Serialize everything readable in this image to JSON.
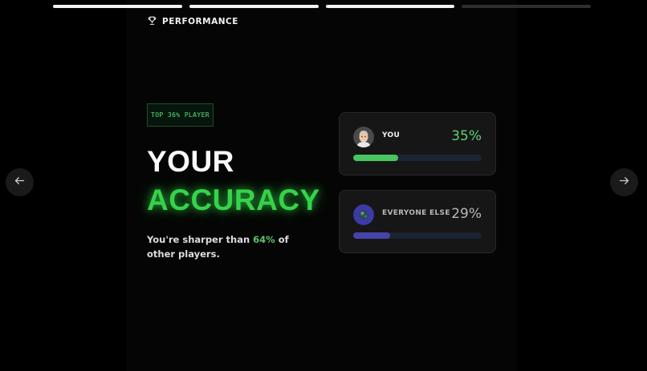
{
  "progress": {
    "total": 4,
    "completed": 3
  },
  "header": {
    "title": "PERFORMANCE",
    "icon": "trophy-icon"
  },
  "badge": {
    "text": "TOP 36% PLAYER"
  },
  "headline": {
    "line1": "YOUR",
    "line2": "ACCURACY"
  },
  "subtitle": {
    "prefix": "You're sharper than ",
    "highlight": "64%",
    "suffix": " of other players."
  },
  "cards": {
    "you": {
      "label": "YOU",
      "value": "35%",
      "fraction": 0.35,
      "color": "#48c55e"
    },
    "everyone_else": {
      "label": "EVERYONE ELSE",
      "value": "29%",
      "fraction": 0.29,
      "color": "#4644a8"
    }
  },
  "nav": {
    "prev_icon": "arrow-left-icon",
    "next_icon": "arrow-right-icon"
  },
  "colors": {
    "accent": "#35d34a",
    "background": "#000000",
    "card": "#161616"
  }
}
